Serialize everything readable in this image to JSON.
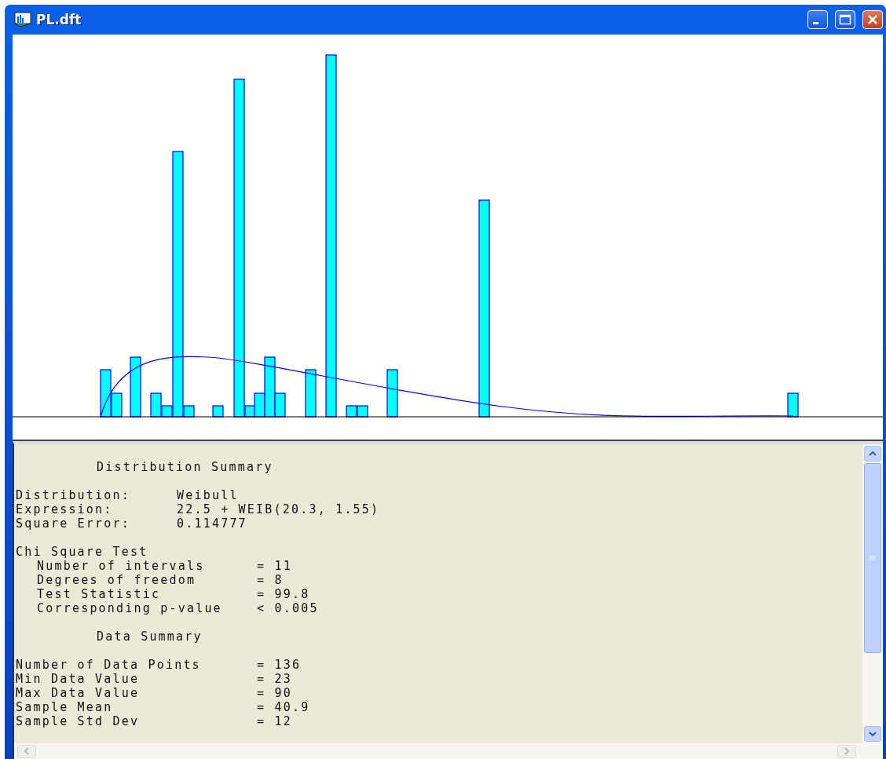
{
  "window": {
    "title": "PL.dft"
  },
  "summary": {
    "lines": [
      {
        "kind": "heading",
        "text": "Distribution Summary"
      },
      {
        "kind": "blank"
      },
      {
        "kind": "row",
        "label": "Distribution:",
        "value": "Weibull"
      },
      {
        "kind": "row",
        "label": "Expression:",
        "value": "22.5 + WEIB(20.3, 1.55)"
      },
      {
        "kind": "row",
        "label": "Square Error:",
        "value": "0.114777"
      },
      {
        "kind": "blank"
      },
      {
        "kind": "title",
        "text": "Chi Square Test"
      },
      {
        "kind": "sub",
        "label": "Number of intervals",
        "value": "= 11"
      },
      {
        "kind": "sub",
        "label": "Degrees of freedom",
        "value": "= 8"
      },
      {
        "kind": "sub",
        "label": "Test Statistic",
        "value": "= 99.8"
      },
      {
        "kind": "sub",
        "label": "Corresponding p-value",
        "value": "< 0.005"
      },
      {
        "kind": "blank"
      },
      {
        "kind": "heading",
        "text": "Data Summary"
      },
      {
        "kind": "blank"
      },
      {
        "kind": "stat",
        "label": "Number of Data Points",
        "value": "= 136"
      },
      {
        "kind": "stat",
        "label": "Min Data Value",
        "value": "= 23"
      },
      {
        "kind": "stat",
        "label": "Max Data Value",
        "value": "= 90"
      },
      {
        "kind": "stat",
        "label": "Sample Mean",
        "value": "= 40.9"
      },
      {
        "kind": "stat",
        "label": "Sample Std Dev",
        "value": "= 12"
      }
    ]
  }
}
